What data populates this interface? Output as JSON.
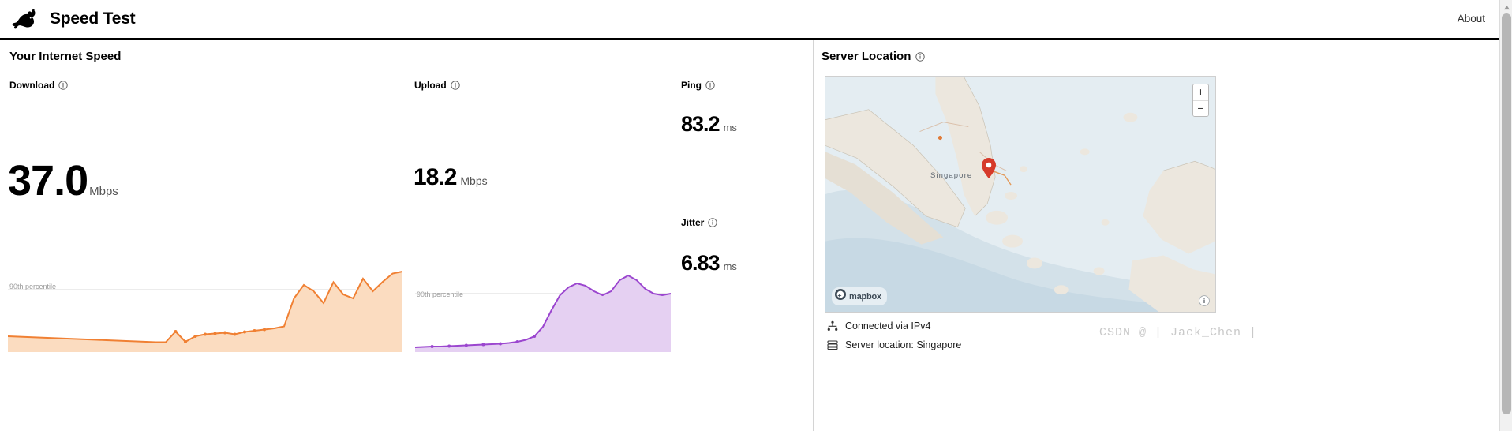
{
  "header": {
    "logo_icon": "rabbit-icon",
    "title": "Speed Test",
    "about_label": "About"
  },
  "left": {
    "section_title": "Your Internet Speed",
    "download": {
      "label": "Download",
      "info_icon": "info-icon",
      "value": "37.0",
      "unit": "Mbps",
      "percentile_label": "90th percentile",
      "color": "#f08033"
    },
    "upload": {
      "label": "Upload",
      "info_icon": "info-icon",
      "value": "18.2",
      "unit": "Mbps",
      "percentile_label": "90th percentile",
      "color": "#9b46cf"
    },
    "ping": {
      "label": "Ping",
      "info_icon": "info-icon",
      "value": "83.2",
      "unit": "ms"
    },
    "jitter": {
      "label": "Jitter",
      "info_icon": "info-icon",
      "value": "6.83",
      "unit": "ms"
    }
  },
  "right": {
    "section_title": "Server Location",
    "info_icon": "info-icon",
    "map": {
      "city_label": "Singapore",
      "pin_icon": "map-pin-icon",
      "zoom_in_label": "+",
      "zoom_out_label": "−",
      "attribution": "mapbox",
      "attribution_icon": "mapbox-logo-icon",
      "info_badge_icon": "info-circle-icon"
    },
    "connection": [
      {
        "icon": "network-icon",
        "text": "Connected via IPv4"
      },
      {
        "icon": "server-icon",
        "text": "Server location: Singapore"
      }
    ]
  },
  "watermark": "CSDN @ | Jack_Chen |",
  "scrollbar": {
    "up_arrow_icon": "triangle-up-icon"
  },
  "chart_data": [
    {
      "type": "area",
      "title": "Download speed sparkline",
      "name": "download",
      "color": "#f08033",
      "fill": "#fbdcc0",
      "ylabel": "Mbps",
      "annotation": "90th percentile",
      "x": [
        0,
        1,
        2,
        3,
        4,
        5,
        6,
        7,
        8,
        9,
        10,
        11,
        12,
        13,
        14,
        15,
        16,
        17,
        18,
        19,
        20,
        21,
        22,
        23,
        24,
        25,
        26,
        27,
        28,
        29,
        30,
        31,
        32,
        33,
        34,
        35,
        36,
        37,
        38,
        39,
        40
      ],
      "values": [
        7.5,
        7.4,
        7.3,
        7.2,
        7.1,
        7.0,
        6.9,
        6.8,
        6.7,
        6.6,
        6.5,
        6.4,
        6.3,
        6.2,
        6.1,
        6.0,
        6.0,
        9.0,
        6.2,
        7.5,
        8.0,
        8.2,
        8.4,
        8.0,
        8.6,
        8.9,
        9.2,
        9.5,
        10.0,
        24.0,
        30.0,
        27.0,
        22.0,
        31.5,
        26.0,
        24.0,
        33.5,
        27.0,
        31.0,
        36.0,
        37.0
      ],
      "ylim": [
        0,
        40
      ],
      "grid": false,
      "legend": "none"
    },
    {
      "type": "area",
      "title": "Upload speed sparkline",
      "name": "upload",
      "color": "#9b46cf",
      "fill": "#e5d0f2",
      "ylabel": "Mbps",
      "annotation": "90th percentile",
      "x": [
        0,
        1,
        2,
        3,
        4,
        5,
        6,
        7,
        8,
        9,
        10,
        11,
        12,
        13,
        14,
        15,
        16,
        17,
        18,
        19,
        20,
        21,
        22,
        23,
        24,
        25,
        26,
        27,
        28,
        29,
        30
      ],
      "values": [
        1.2,
        1.3,
        1.4,
        1.4,
        1.5,
        1.6,
        1.7,
        1.8,
        1.9,
        2.0,
        2.1,
        2.3,
        2.6,
        3.0,
        3.6,
        5.5,
        9.5,
        13.5,
        15.5,
        16.3,
        15.8,
        14.5,
        13.5,
        14.5,
        17.0,
        18.2,
        17.0,
        15.0,
        14.0,
        13.6,
        14.0
      ],
      "ylim": [
        0,
        20
      ],
      "grid": false,
      "legend": "none"
    }
  ]
}
